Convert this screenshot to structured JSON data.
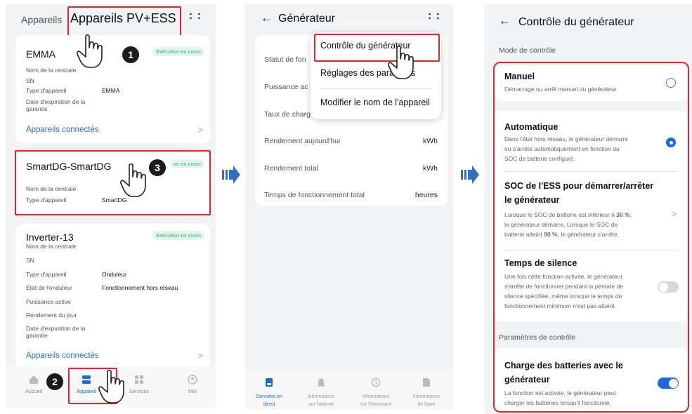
{
  "screen1": {
    "tabs": {
      "tab1": "Appareils",
      "tab2": "Appareils PV+ESS"
    },
    "more_icon": "more-dots-icon",
    "cards": [
      {
        "title": "EMMA",
        "badge": "Exécution en cours",
        "fields": [
          {
            "label": "Nom de la centrale",
            "value": ""
          },
          {
            "label": "SN",
            "value": ""
          },
          {
            "label": "Type d'appareil",
            "value": "EMMA"
          },
          {
            "label": "Date d'expiration de la garantie",
            "value": ""
          }
        ],
        "link": "Appareils connectés"
      },
      {
        "title": "SmartDG-SmartDG",
        "badge": "on en cours",
        "fields": [
          {
            "label": "Nom de la centrale",
            "value": ""
          },
          {
            "label": "Type d'appareil",
            "value": "SmartDG"
          }
        ]
      },
      {
        "title": "Inverter-13",
        "badge": "Exécution en cours",
        "fields": [
          {
            "label": "Nom de la centrale",
            "value": ""
          },
          {
            "label": "SN",
            "value": ""
          },
          {
            "label": "Type d'appareil",
            "value": "Onduleur"
          },
          {
            "label": "État de l'onduleur",
            "value": "Fonctionnement hors réseau"
          },
          {
            "label": "Puissance active",
            "value": ""
          },
          {
            "label": "Rendement du jour",
            "value": ""
          },
          {
            "label": "Date d'expiration de la garantie",
            "value": ""
          }
        ],
        "link": "Appareils connectés"
      }
    ],
    "nav": [
      "Accueil",
      "Appareil",
      "Services",
      "Moi"
    ],
    "step_badges": [
      "1",
      "2",
      "3"
    ]
  },
  "screen2": {
    "title": "Générateur",
    "rows": [
      {
        "label": "Statut de fon",
        "value": ""
      },
      {
        "label": "Puissance ac",
        "value": ""
      },
      {
        "label": "Taux de charg",
        "value": ""
      },
      {
        "label": "Rendement aujourd'hui",
        "value": "kWh"
      },
      {
        "label": "Rendement total",
        "value": "kWh"
      },
      {
        "label": "Temps de fonctionnement total",
        "value": "heures"
      }
    ],
    "menu": [
      "Contrôle du générateur",
      "Réglages des para",
      "s",
      "Modifier le nom de l'appareil"
    ],
    "nav": [
      {
        "l1": "Données en",
        "l2": "direct"
      },
      {
        "l1": "Informations",
        "l2": "sur l'alarme"
      },
      {
        "l1": "Informations",
        "l2": "sur l'historique"
      },
      {
        "l1": "Informations",
        "l2": "de base"
      }
    ],
    "accent": "#1e68d8"
  },
  "screen3": {
    "title": "Contrôle du générateur",
    "section1": "Mode de contrôle",
    "manual": {
      "title": "Manuel",
      "desc": "Démarrage ou arrêt manuel du générateur.",
      "selected": false
    },
    "auto": {
      "title": "Automatique",
      "desc1": "Dans l'état hors réseau, le générateur démarre",
      "desc2": "ou s'arrête automatiquement en fonction du",
      "desc3": "SOC de batterie configuré.",
      "selected": true
    },
    "soc": {
      "title1": "SOC de l'ESS pour démarrer/arrêter",
      "title2": "le générateur",
      "d1a": "Lorsque le SOC de batterie est inférieur à ",
      "d1b": "30 %",
      "d1c": ",",
      "d2": "le générateur démarre. Lorsque le SOC de",
      "d3a": "batterie atteint ",
      "d3b": "90 %",
      "d3c": ", le générateur s'arrête."
    },
    "silence": {
      "title": "Temps de silence",
      "desc1": "Une fois cette fonction activée, le générateur",
      "desc2": "s'arrête de fonctionner pendant la période de",
      "desc3": "silence spécifiée, même lorsque le temps de",
      "desc4": "fonctionnement minimum n'est pas atteint.",
      "enabled": false
    },
    "section2": "Paramètres de contrôle",
    "charge": {
      "title1": "Charge des batteries avec le",
      "title2": "générateur",
      "desc1": "La fonction est activée, le générateur peut",
      "desc2": "charger les batteries lorsqu'il fonctionne.",
      "enabled": true
    }
  },
  "colors": {
    "highlight": "#e5242c",
    "link": "#2c6ccd",
    "accent": "#1e68d8",
    "badge_text": "#2fae6f"
  }
}
